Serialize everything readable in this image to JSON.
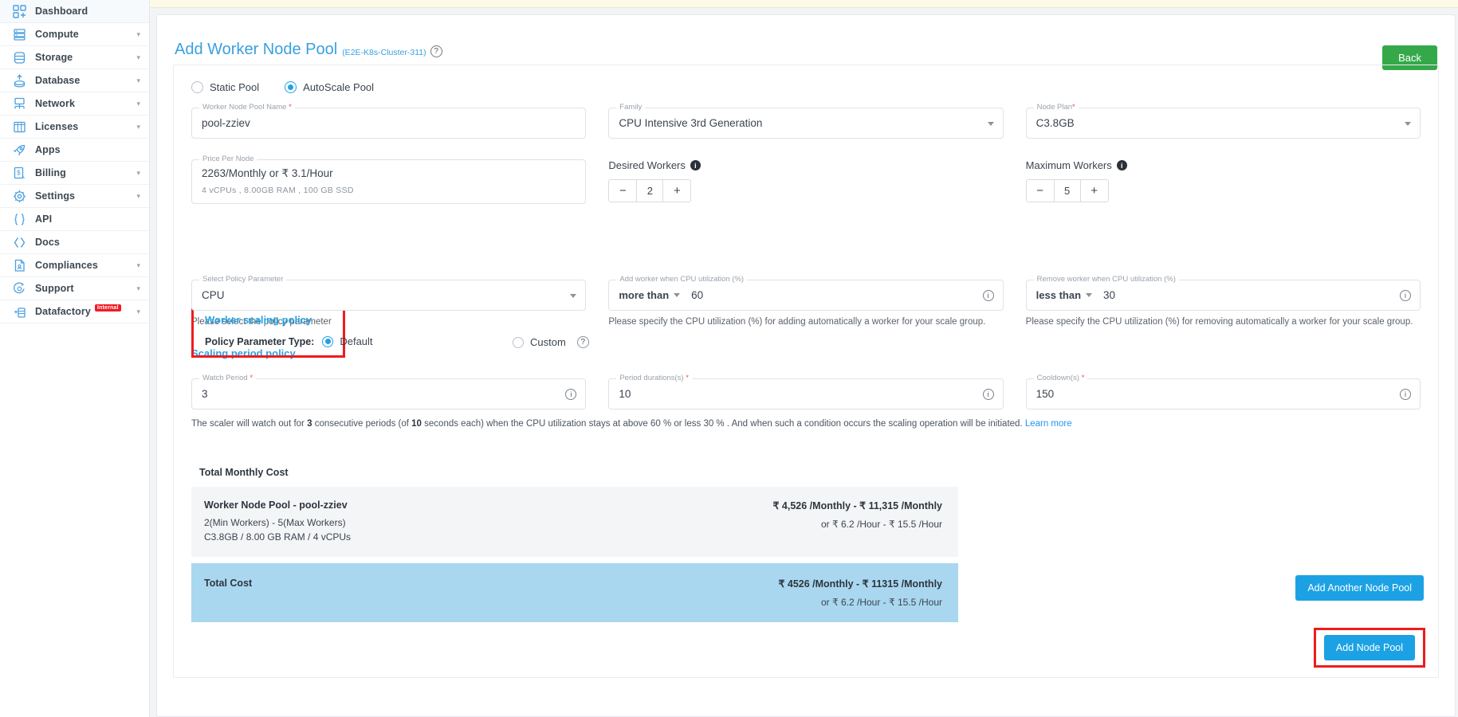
{
  "sidebar": {
    "items": [
      {
        "label": "Dashboard",
        "icon": "dashboard-icon",
        "chevron": false,
        "badge": ""
      },
      {
        "label": "Compute",
        "icon": "server-icon",
        "chevron": true,
        "badge": ""
      },
      {
        "label": "Storage",
        "icon": "database-stack-icon",
        "chevron": true,
        "badge": ""
      },
      {
        "label": "Database",
        "icon": "cloud-database-icon",
        "chevron": true,
        "badge": ""
      },
      {
        "label": "Network",
        "icon": "network-icon",
        "chevron": true,
        "badge": ""
      },
      {
        "label": "Licenses",
        "icon": "license-grid-icon",
        "chevron": true,
        "badge": ""
      },
      {
        "label": "Apps",
        "icon": "rocket-icon",
        "chevron": false,
        "badge": ""
      },
      {
        "label": "Billing",
        "icon": "invoice-icon",
        "chevron": true,
        "badge": ""
      },
      {
        "label": "Settings",
        "icon": "gear-icon",
        "chevron": true,
        "badge": ""
      },
      {
        "label": "API",
        "icon": "braces-icon",
        "chevron": false,
        "badge": ""
      },
      {
        "label": "Docs",
        "icon": "code-brackets-icon",
        "chevron": false,
        "badge": ""
      },
      {
        "label": "Compliances",
        "icon": "document-icon",
        "chevron": true,
        "badge": ""
      },
      {
        "label": "Support",
        "icon": "lifebuoy-icon",
        "chevron": true,
        "badge": ""
      },
      {
        "label": "Datafactory",
        "icon": "datafactory-icon",
        "chevron": true,
        "badge": "Internal"
      }
    ]
  },
  "header": {
    "title": "Add Worker Node Pool",
    "cluster": "(E2E-K8s-Cluster-311)",
    "help_icon": "?",
    "back_label": "Back"
  },
  "pool_type": {
    "static_label": "Static Pool",
    "autoscale_label": "AutoScale Pool",
    "selected": "AutoScale Pool"
  },
  "fields": {
    "name": {
      "legend": "Worker Node Pool Name",
      "required": true,
      "value": "pool-zziev"
    },
    "family": {
      "legend": "Family",
      "required": false,
      "value": "CPU Intensive 3rd Generation"
    },
    "node_plan": {
      "legend": "Node Plan",
      "required": true,
      "value": "C3.8GB"
    },
    "price": {
      "legend": "Price Per Node",
      "required": false,
      "value": "2263/Monthly or ₹ 3.1/Hour",
      "spec": "4  vCPUs ,  8.00GB RAM ,   100 GB SSD"
    },
    "desired_workers": {
      "label": "Desired Workers",
      "value": "2",
      "minus": "−",
      "plus": "+"
    },
    "maximum_workers": {
      "label": "Maximum Workers",
      "value": "5",
      "minus": "−",
      "plus": "+"
    }
  },
  "worker_scaling_policy": {
    "title": "Worker scaling policy",
    "param_type_label": "Policy Parameter Type:",
    "default_label": "Default",
    "custom_label": "Custom",
    "selected": "Default",
    "help_icon": "?"
  },
  "policy_fields": {
    "select_policy": {
      "legend": "Select Policy Parameter",
      "value": "CPU",
      "hint": "Please select the policy parameter"
    },
    "add_worker": {
      "legend": "Add worker when CPU utilization (%)",
      "operator": "more than",
      "value": "60",
      "hint": "Please specify the CPU utilization (%) for adding automatically a worker for your scale group."
    },
    "remove_worker": {
      "legend": "Remove worker when CPU utilization (%)",
      "operator": "less than",
      "value": "30",
      "hint": "Please specify the CPU utilization (%) for removing automatically a worker for your scale group."
    }
  },
  "scaling_period_policy": {
    "title": "Scaling period policy",
    "watch_period": {
      "legend": "Watch Period",
      "required": true,
      "value": "3"
    },
    "period_duration": {
      "legend": "Period durations(s)",
      "required": true,
      "value": "10"
    },
    "cooldown": {
      "legend": "Cooldown(s)",
      "required": true,
      "value": "150"
    },
    "description_1": "The scaler will watch out for ",
    "description_b1": "3",
    "description_2": " consecutive periods (of ",
    "description_b2": "10",
    "description_3": " seconds each) when the CPU utilization stays at above 60 % or less 30 % . And when such a condition occurs the scaling operation will be initiated. ",
    "learn_more": "Learn more"
  },
  "cost": {
    "heading": "Total Monthly Cost",
    "pool_row": {
      "title": "Worker Node Pool - pool-zziev",
      "workers": "2(Min Workers) - 5(Max Workers)",
      "spec": "C3.8GB / 8.00 GB RAM / 4 vCPUs",
      "monthly": "₹ 4,526 /Monthly - ₹ 11,315 /Monthly",
      "hourly": "or ₹ 6.2 /Hour - ₹ 15.5 /Hour"
    },
    "total_row": {
      "title": "Total Cost",
      "monthly": "₹ 4526 /Monthly - ₹ 11315 /Monthly",
      "hourly": "or ₹ 6.2 /Hour - ₹ 15.5 /Hour"
    },
    "add_another_label": "Add Another Node Pool",
    "add_pool_label": "Add Node Pool"
  },
  "colors": {
    "accent_blue": "#1ca2e4",
    "title_blue": "#39a0e0",
    "back_green": "#35a94a",
    "highlight_red": "#ee1c1c",
    "total_bg": "#a9d7f0"
  }
}
